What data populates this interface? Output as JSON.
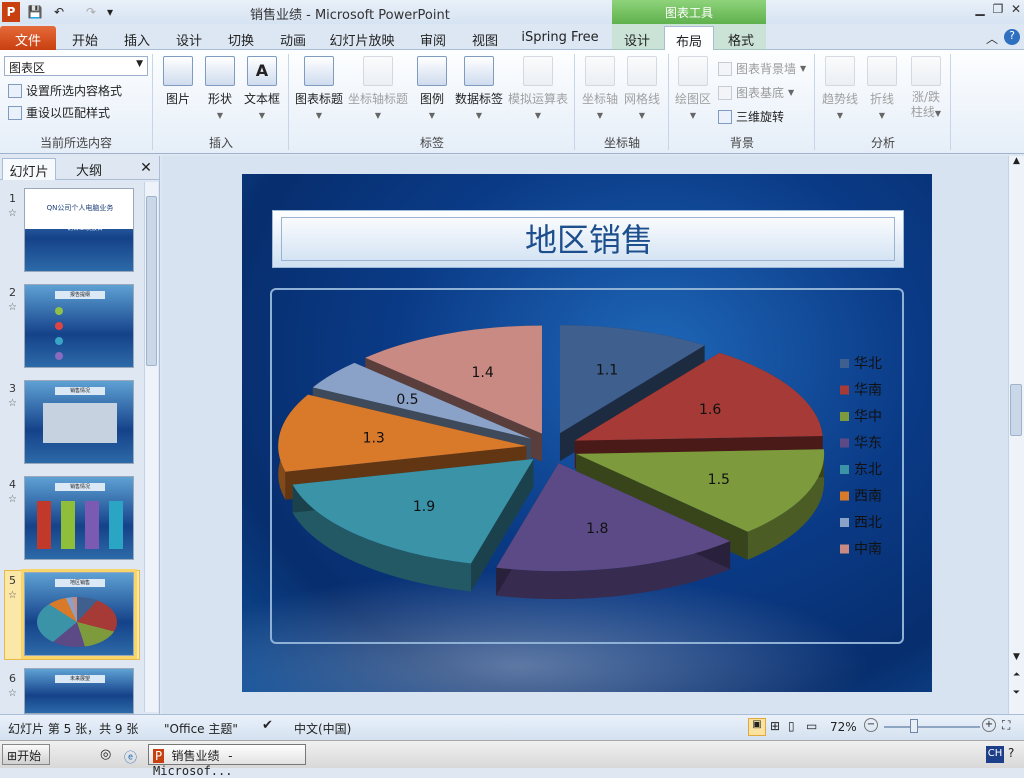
{
  "window": {
    "title": "销售业绩 - Microsoft PowerPoint",
    "context_tab": "图表工具"
  },
  "tabs": [
    "文件",
    "开始",
    "插入",
    "设计",
    "切换",
    "动画",
    "幻灯片放映",
    "审阅",
    "视图",
    "iSpring Free",
    "设计",
    "布局",
    "格式"
  ],
  "active_tab": "布局",
  "ribbon": {
    "current_selection": {
      "dropdown_value": "图表区",
      "format_selection": "设置所选内容格式",
      "reset_style": "重设以匹配样式",
      "group_label": "当前所选内容"
    },
    "insert": {
      "picture": "图片",
      "shapes": "形状",
      "textbox": "文本框",
      "group_label": "插入"
    },
    "labels": {
      "chart_title": "图表标题",
      "axis_titles": "坐标轴标题",
      "legend": "图例",
      "data_labels": "数据标签",
      "data_table": "模拟运算表",
      "group_label": "标签"
    },
    "axes": {
      "axes": "坐标轴",
      "gridlines": "网格线",
      "group_label": "坐标轴"
    },
    "background": {
      "plot_area": "绘图区",
      "chart_wall": "图表背景墙",
      "chart_floor": "图表基底",
      "rotation_3d": "三维旋转",
      "group_label": "背景"
    },
    "analysis": {
      "trendline": "趋势线",
      "lines": "折线",
      "updown_bars_1": "涨/跌",
      "updown_bars_2": "柱线",
      "group_label": "分析"
    }
  },
  "left_pane": {
    "tab_slides": "幻灯片",
    "tab_outline": "大纲",
    "close": "✕",
    "slides": [
      {
        "num": "1",
        "title": "QN公司个人电脑业务",
        "subtitle": "——销售业绩报告"
      },
      {
        "num": "2",
        "title": "报告提纲"
      },
      {
        "num": "3",
        "title": "销售情况"
      },
      {
        "num": "4",
        "title": "销售情况"
      },
      {
        "num": "5",
        "title": "地区销售",
        "selected": true
      },
      {
        "num": "6",
        "title": "未来展望"
      }
    ]
  },
  "slide": {
    "title": "地区销售"
  },
  "chart_data": {
    "type": "pie",
    "title": "地区销售",
    "categories": [
      "华北",
      "华南",
      "华中",
      "华东",
      "东北",
      "西南",
      "西北",
      "中南"
    ],
    "values": [
      1.1,
      1.6,
      1.5,
      1.8,
      1.9,
      1.3,
      0.5,
      1.4
    ],
    "colors": [
      "#3f5f8e",
      "#a53a36",
      "#7d9a3c",
      "#5c4a86",
      "#3b93a8",
      "#d9792a",
      "#8aa2c8",
      "#c98a84"
    ],
    "legend_position": "right",
    "exploded": true,
    "three_d": true,
    "data_labels": true
  },
  "status": {
    "slide_info": "幻灯片 第 5 张，共 9 张",
    "theme": "\"Office 主题\"",
    "language": "中文(中国)",
    "zoom": "72%"
  },
  "taskbar": {
    "start": "开始",
    "task": "销售业绩 - Microsof...",
    "ime": "CH"
  }
}
